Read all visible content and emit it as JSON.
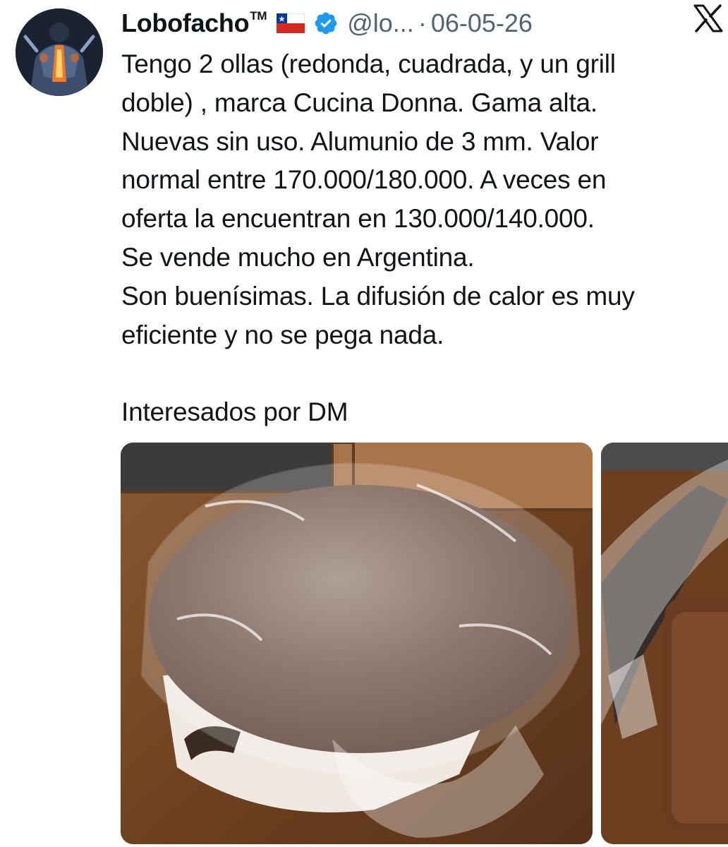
{
  "author": {
    "display_name": "Lobofacho",
    "trademark": "TM",
    "handle": "@lo...",
    "separator": "·",
    "date": "06-05-26",
    "flag_icon": "chile-flag-icon",
    "verified_icon": "verified-badge-icon",
    "verified_color": "#1d9bf0"
  },
  "tweet": {
    "lines": [
      "Tengo 2 ollas (redonda, cuadrada, y un grill",
      "doble) , marca Cucina Donna. Gama alta.",
      "Nuevas sin uso. Alumunio de 3 mm.  Valor",
      "normal entre 170.000/180.000. A veces en",
      "oferta la encuentran en 130.000/140.000.",
      "Se vende mucho en Argentina.",
      "Son buenísimas. La difusión de calor es muy",
      "eficiente y no se pega nada.",
      "",
      "Interesados por DM"
    ]
  },
  "media": [
    {
      "icon": "photo-wrapped-pot"
    },
    {
      "icon": "photo-wrapped-pans"
    }
  ],
  "app": {
    "logo_icon": "x-logo-icon"
  },
  "colors": {
    "text": "#0f1419",
    "muted": "#536471",
    "accent": "#1d9bf0"
  }
}
